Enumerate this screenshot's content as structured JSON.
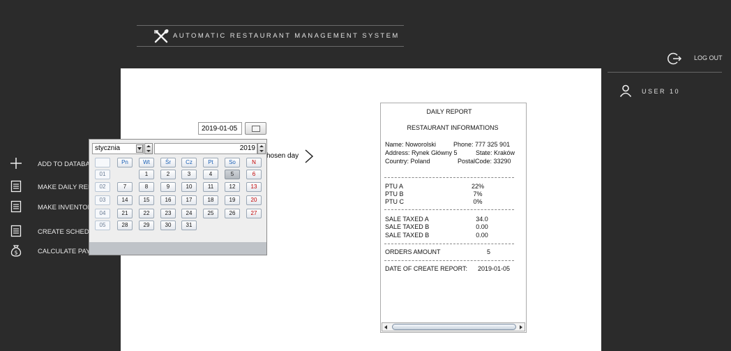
{
  "header": {
    "title": "AUTOMATIC RESTAURANT MANAGEMENT SYSTEM",
    "logo_icon": "utensils-icon"
  },
  "account": {
    "logout_label": "LOG OUT",
    "user_label": "USER 10"
  },
  "sidebar": {
    "items": [
      {
        "label": "ADD TO DATABAS",
        "icon": "plus-icon"
      },
      {
        "label": "MAKE DAILY REP",
        "icon": "report-icon"
      },
      {
        "label": "MAKE INVENTOR",
        "icon": "report-icon"
      },
      {
        "label": "CREATE SCHED",
        "icon": "report-icon"
      },
      {
        "label": "CALCULATE PAY",
        "icon": "money-bag-icon"
      }
    ]
  },
  "date_picker": {
    "value": "2019-01-05",
    "chosen_day_label": "hosen day",
    "month": "stycznia",
    "year": "2019",
    "headers": [
      "Pn",
      "Wt",
      "Śr",
      "Cz",
      "Pt",
      "So",
      "N"
    ],
    "weeks": [
      {
        "num": "01",
        "days": [
          "",
          "1",
          "2",
          "3",
          "4",
          "5",
          "6"
        ]
      },
      {
        "num": "02",
        "days": [
          "7",
          "8",
          "9",
          "10",
          "11",
          "12",
          "13"
        ]
      },
      {
        "num": "03",
        "days": [
          "14",
          "15",
          "16",
          "17",
          "18",
          "19",
          "20"
        ]
      },
      {
        "num": "04",
        "days": [
          "21",
          "22",
          "23",
          "24",
          "25",
          "26",
          "27"
        ]
      },
      {
        "num": "05",
        "days": [
          "28",
          "29",
          "30",
          "31",
          "",
          "",
          ""
        ]
      }
    ],
    "selected_day": "5"
  },
  "report": {
    "title": "DAILY REPORT",
    "subtitle": "RESTAURANT INFORMATIONS",
    "name": "Name:  Noworolski",
    "phone": "Phone:  777 325 901",
    "address": "Address:  Rynek Główny 5",
    "state": "State:  Kraków",
    "country": "Country:  Poland",
    "postal": "PostalCode:  33290",
    "ptu": [
      {
        "label": "PTU A",
        "value": "22%"
      },
      {
        "label": "PTU B",
        "value": "7%"
      },
      {
        "label": "PTU C",
        "value": "0%"
      }
    ],
    "sales": [
      {
        "label": "SALE TAXED A",
        "value": "34.0"
      },
      {
        "label": "SALE TAXED B",
        "value": "0.00"
      },
      {
        "label": "SALE TAXED B",
        "value": "0.00"
      }
    ],
    "orders_label": "ORDERS AMOUNT",
    "orders_value": "5",
    "date_label": "DATE OF CREATE REPORT:",
    "date_value": "2019-01-05"
  },
  "colors": {
    "background": "#2b2b2b",
    "panel": "#ffffff",
    "sunday": "#c00000",
    "weekday_header": "#1a5fb4"
  }
}
